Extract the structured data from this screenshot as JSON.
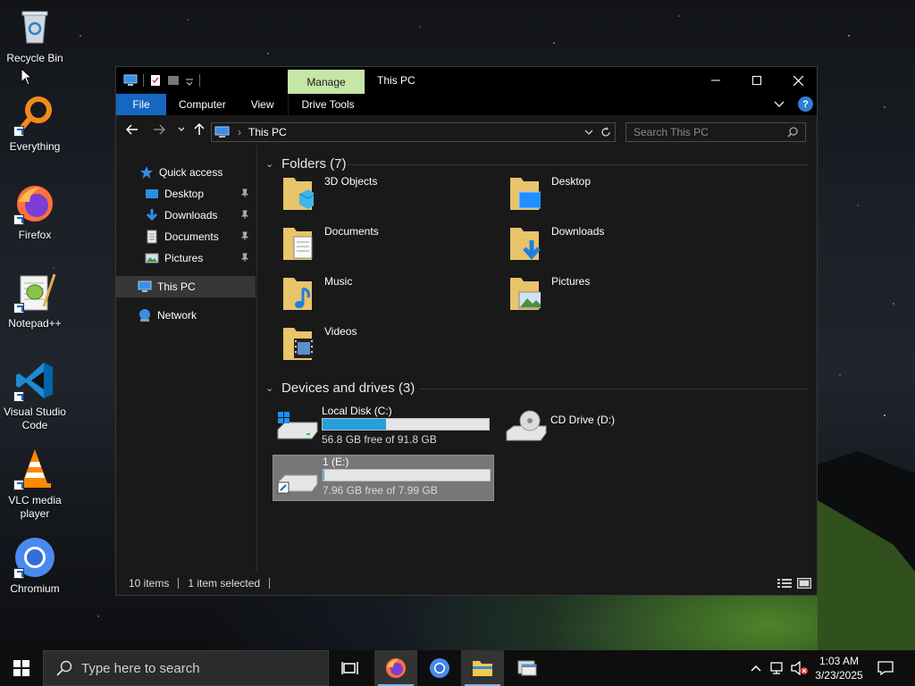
{
  "desktop": {
    "icons": [
      {
        "label": "Recycle Bin",
        "icon": "recycle-bin-icon"
      },
      {
        "label": "Everything",
        "icon": "everything-search-icon"
      },
      {
        "label": "Firefox",
        "icon": "firefox-icon"
      },
      {
        "label": "Notepad++",
        "icon": "notepadpp-icon"
      },
      {
        "label": "Visual Studio Code",
        "icon": "vscode-icon"
      },
      {
        "label": "VLC media player",
        "icon": "vlc-icon"
      },
      {
        "label": "Chromium",
        "icon": "chromium-icon"
      }
    ]
  },
  "explorer": {
    "title": "This PC",
    "manage_tab": "Manage",
    "ribbon_tabs": [
      "File",
      "Computer",
      "View",
      "Drive Tools"
    ],
    "address": {
      "location": "This PC"
    },
    "search": {
      "placeholder": "Search This PC"
    },
    "nav": {
      "quick_access": "Quick access",
      "pinned": [
        "Desktop",
        "Downloads",
        "Documents",
        "Pictures"
      ],
      "this_pc": "This PC",
      "network": "Network"
    },
    "folders_header": "Folders (7)",
    "folders": [
      "3D Objects",
      "Desktop",
      "Documents",
      "Downloads",
      "Music",
      "Pictures",
      "Videos"
    ],
    "devices_header": "Devices and drives (3)",
    "drives": [
      {
        "name": "Local Disk (C:)",
        "free_text": "56.8 GB free of 91.8 GB",
        "used_fraction": 0.38
      },
      {
        "name": "CD Drive (D:)"
      },
      {
        "name": "1 (E:)",
        "free_text": "7.96 GB free of 7.99 GB",
        "used_fraction": 0.004
      }
    ],
    "status": {
      "items": "10 items",
      "selected": "1 item selected"
    }
  },
  "taskbar": {
    "search_placeholder": "Type here to search",
    "time": "1:03 AM",
    "date": "3/23/2025"
  },
  "colors": {
    "accent": "#1667c0",
    "manage_tab": "#c5e6a6",
    "drive_fill": "#26a0da"
  }
}
